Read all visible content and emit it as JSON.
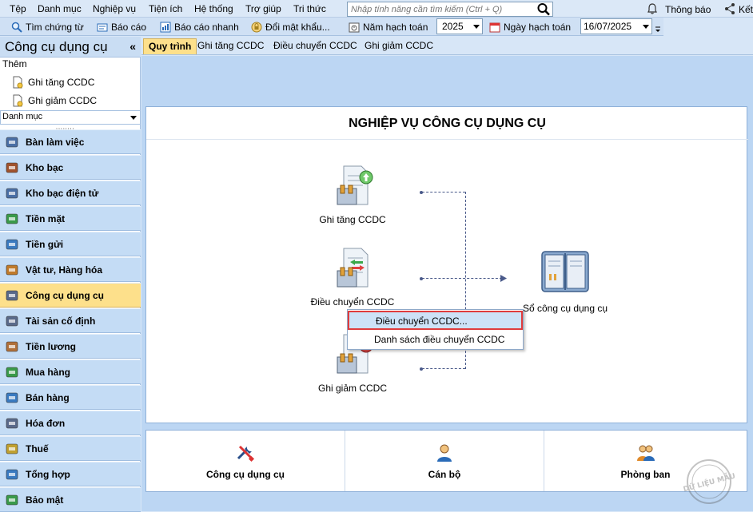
{
  "menu": [
    "Tệp",
    "Danh mục",
    "Nghiệp vụ",
    "Tiện ích",
    "Hệ thống",
    "Trợ giúp",
    "Tri thức"
  ],
  "search": {
    "placeholder": "Nhập tính năng cần tìm kiếm (Ctrl + Q)"
  },
  "notifications": "Thông báo",
  "connect": "Kết",
  "toolbar": {
    "find_voucher": "Tìm chứng từ",
    "report": "Báo cáo",
    "quick_report": "Báo cáo nhanh",
    "change_password": "Đổi mật khẩu...",
    "fiscal_year_label": "Năm hạch toán",
    "fiscal_year_value": "2025",
    "posting_date_label": "Ngày hạch toán",
    "posting_date_value": "16/07/2025"
  },
  "sidebar": {
    "title": "Công cụ dụng cụ",
    "add_label": "Thêm",
    "quick_actions": [
      "Ghi tăng CCDC",
      "Ghi giảm CCDC"
    ],
    "category_select": "Danh mục",
    "items": [
      {
        "label": "Bàn làm việc",
        "active": false
      },
      {
        "label": "Kho bạc",
        "active": false
      },
      {
        "label": "Kho bạc điện tử",
        "active": false
      },
      {
        "label": "Tiền mặt",
        "active": false
      },
      {
        "label": "Tiền gửi",
        "active": false
      },
      {
        "label": "Vật tư, Hàng hóa",
        "active": false
      },
      {
        "label": "Công cụ dụng cụ",
        "active": true
      },
      {
        "label": "Tài sản cố định",
        "active": false
      },
      {
        "label": "Tiền lương",
        "active": false
      },
      {
        "label": "Mua hàng",
        "active": false
      },
      {
        "label": "Bán hàng",
        "active": false
      },
      {
        "label": "Hóa đơn",
        "active": false
      },
      {
        "label": "Thuế",
        "active": false
      },
      {
        "label": "Tổng hợp",
        "active": false
      },
      {
        "label": "Bảo mật",
        "active": false
      }
    ]
  },
  "tabs": [
    {
      "label": "Quy trình",
      "active": true
    },
    {
      "label": "Ghi tăng CCDC",
      "active": false
    },
    {
      "label": "Điều chuyển CCDC",
      "active": false
    },
    {
      "label": "Ghi giảm CCDC",
      "active": false
    }
  ],
  "process": {
    "title": "NGHIỆP VỤ CÔNG CỤ DỤNG CỤ",
    "increase": "Ghi tăng CCDC",
    "transfer": "Điều chuyển CCDC",
    "decrease": "Ghi giảm CCDC",
    "ledger": "Sổ công cụ dụng cụ"
  },
  "context_menu": {
    "items": [
      "Điều chuyển CCDC...",
      "Danh sách điều chuyển CCDC"
    ],
    "highlighted": "Điều chuyển CCDC..."
  },
  "bottom": {
    "tools": "Công cụ dụng cụ",
    "staff": "Cán bộ",
    "departments": "Phòng ban"
  },
  "watermark": "DỮ LIỆU MẪU",
  "colors": {
    "active_item": "#fde08b",
    "nav_bg": "#c4dcf5",
    "highlight_border": "#e03c3c"
  }
}
